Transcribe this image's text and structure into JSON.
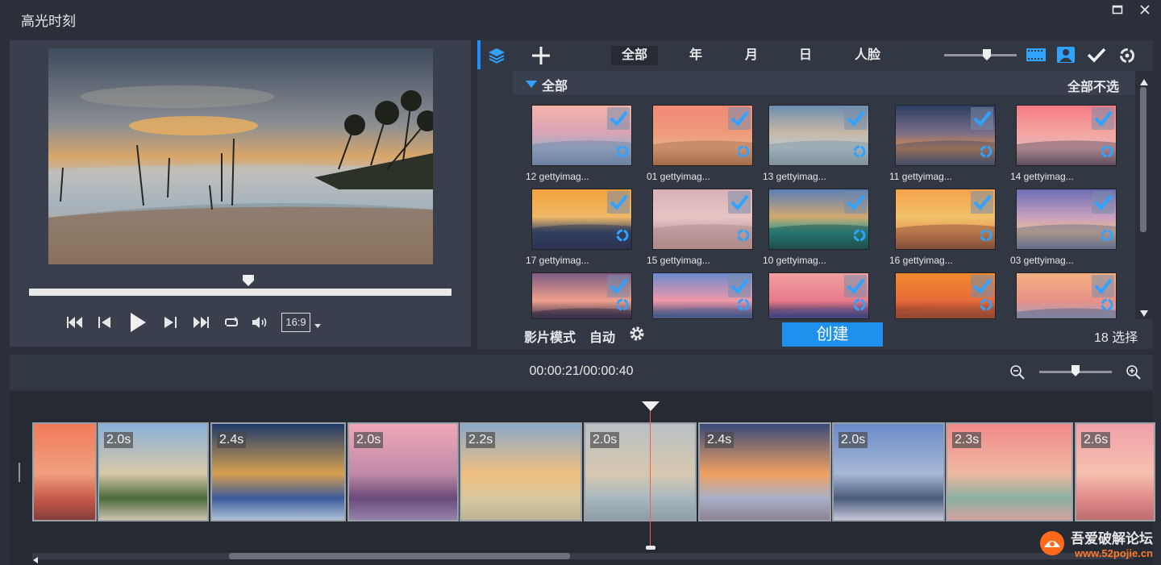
{
  "window": {
    "title": "高光时刻"
  },
  "preview": {
    "aspect_ratio": "16:9",
    "progress_fraction": 0.52
  },
  "library": {
    "tabs": [
      "全部",
      "年",
      "月",
      "日",
      "人脸"
    ],
    "active_tab": "全部",
    "section_title": "全部",
    "deselect_all": "全部不选",
    "items": [
      {
        "label": "12 gettyimag...",
        "checked": true
      },
      {
        "label": "01 gettyimag...",
        "checked": true
      },
      {
        "label": "13 gettyimag...",
        "checked": true
      },
      {
        "label": "11 gettyimag...",
        "checked": true
      },
      {
        "label": "14 gettyimag...",
        "checked": true
      },
      {
        "label": "17 gettyimag...",
        "checked": true
      },
      {
        "label": "15 gettyimag...",
        "checked": true
      },
      {
        "label": "10 gettyimag...",
        "checked": true
      },
      {
        "label": "16 gettyimag...",
        "checked": true
      },
      {
        "label": "03 gettyimag...",
        "checked": true
      },
      {
        "label": "",
        "checked": true
      },
      {
        "label": "",
        "checked": true
      },
      {
        "label": "",
        "checked": true
      },
      {
        "label": "",
        "checked": true
      },
      {
        "label": "",
        "checked": true
      }
    ],
    "footer": {
      "movie_mode_label": "影片模式",
      "movie_mode_value": "自动",
      "create_label": "创建",
      "selected_count": "18 选择"
    }
  },
  "timeline": {
    "timecode": "00:00:21/00:00:40",
    "zoom_level": 0.5,
    "clips": [
      {
        "duration": ""
      },
      {
        "duration": "2.0s"
      },
      {
        "duration": "2.4s"
      },
      {
        "duration": "2.0s"
      },
      {
        "duration": "2.2s"
      },
      {
        "duration": "2.0s"
      },
      {
        "duration": "2.4s"
      },
      {
        "duration": "2.0s"
      },
      {
        "duration": "2.3s"
      },
      {
        "duration": "2.6s"
      }
    ]
  },
  "watermark": {
    "line1": "吾爱破解论坛",
    "line2": "www.52pojie.cn"
  },
  "colors": {
    "accent": "#1e90ee",
    "playhead": "#ff5a3c",
    "check": "#2fa3ff"
  }
}
